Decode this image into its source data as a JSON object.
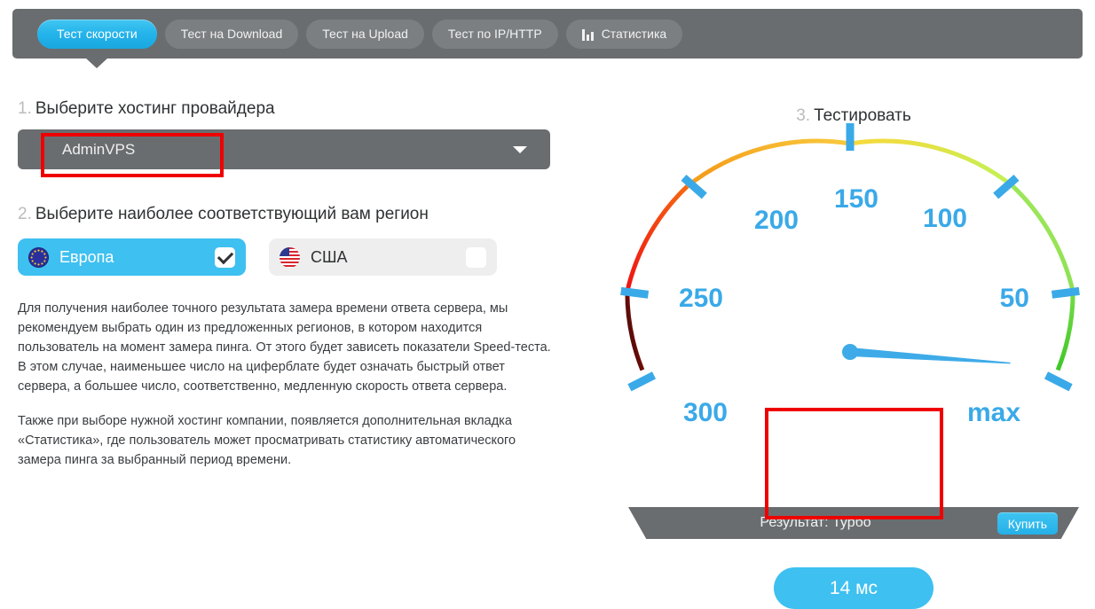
{
  "tabs": [
    {
      "id": "speed",
      "label": "Тест скорости",
      "active": true,
      "icon": null
    },
    {
      "id": "download",
      "label": "Тест на Download",
      "active": false,
      "icon": null
    },
    {
      "id": "upload",
      "label": "Тест на Upload",
      "active": false,
      "icon": null
    },
    {
      "id": "iphttp",
      "label": "Тест по IP/HTTP",
      "active": false,
      "icon": null
    },
    {
      "id": "stats",
      "label": "Статистика",
      "active": false,
      "icon": "bar-chart-icon"
    }
  ],
  "steps": {
    "one": {
      "number": "1.",
      "title": "Выберите хостинг провайдера"
    },
    "two": {
      "number": "2.",
      "title": "Выберите наиболее соответствующий вам регион"
    },
    "three": {
      "number": "3.",
      "title": "Тестировать"
    }
  },
  "provider_select": {
    "value": "AdminVPS",
    "caret_icon": "chevron-down-icon"
  },
  "regions": [
    {
      "id": "europe",
      "label": "Европа",
      "flag": "eu-flag-icon",
      "selected": true
    },
    {
      "id": "usa",
      "label": "США",
      "flag": "us-flag-icon",
      "selected": false
    }
  ],
  "description": {
    "paragraph1": "Для получения наиболее точного результата замера времени ответа сервера, мы рекомендуем выбрать один из предложенных регионов, в котором находится пользователь на момент замера пинга. От этого будет зависеть показатели Speed-теста. В этом случае, наименьшее число на циферблате будет означать быстрый ответ сервера, а большее число, соответственно, медленную скорость ответа сервера.",
    "paragraph2": "Также при выборе нужной хостинг компании, появляется дополнительная вкладка «Статистика», где пользователь может просматривать статистику автоматического замера пинга за выбранный период времени."
  },
  "gauge": {
    "result_label": "Результат: Турбо",
    "buy_button": "Купить",
    "result_value": "14 мс",
    "needle_angle_deg": 4,
    "tick_labels": [
      "max",
      "50",
      "100",
      "150",
      "200",
      "250",
      "300"
    ],
    "colors": {
      "accent_blue": "#3ec0f0",
      "tick_blue": "#3aa9e8",
      "green": "#5fd13a",
      "light_green": "#8fe05a",
      "yellow": "#f5d33c",
      "orange": "#f5a623",
      "red": "#ee1111",
      "dark": "#3a140c",
      "bar_gray": "#6a6d70"
    }
  },
  "annotations": [
    {
      "id": "provider-highlight",
      "color": "#ef0000"
    },
    {
      "id": "result-highlight",
      "color": "#ef0000"
    }
  ],
  "chart_data": {
    "type": "gauge",
    "title": "Тестировать",
    "unit": "мс",
    "value": 14,
    "value_label": "14 мс",
    "status": "Турбо",
    "scale_direction": "descending-clockwise",
    "ticks": [
      {
        "label": "max",
        "angle_deg": 5,
        "position": "bottom-right"
      },
      {
        "label": "50",
        "angle_deg": 50,
        "position": "right"
      },
      {
        "label": "100",
        "angle_deg": 90,
        "position": "upper-right"
      },
      {
        "label": "150",
        "angle_deg": 135,
        "position": "top"
      },
      {
        "label": "200",
        "angle_deg": 180,
        "position": "upper-left"
      },
      {
        "label": "250",
        "angle_deg": 220,
        "position": "left"
      },
      {
        "label": "300",
        "angle_deg": 265,
        "position": "bottom-left"
      }
    ],
    "arc_segments": [
      {
        "from": "max",
        "to": "50",
        "color": "#4cc62a"
      },
      {
        "from": "50",
        "to": "100",
        "color": "#8fe05a"
      },
      {
        "from": "100",
        "to": "150",
        "color": "#f5d33c"
      },
      {
        "from": "150",
        "to": "200",
        "color": "#f5a623"
      },
      {
        "from": "200",
        "to": "250",
        "color": "#ee1111"
      },
      {
        "from": "250",
        "to": "300",
        "color": "#3a140c"
      }
    ]
  }
}
